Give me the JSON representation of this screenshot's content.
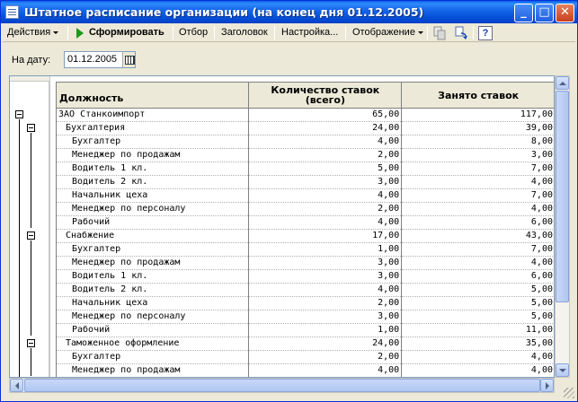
{
  "window": {
    "title": "Штатное расписание организации (на конец дня 01.12.2005)",
    "minimize": "_",
    "maximize": "□",
    "close": "✕"
  },
  "toolbar": {
    "actions": "Действия",
    "generate": "Сформировать",
    "filter": "Отбор",
    "header": "Заголовок",
    "settings": "Настройка...",
    "display": "Отображение",
    "help": "?"
  },
  "date_field": {
    "label": "На дату:",
    "value": "01.12.2005"
  },
  "table": {
    "columns": [
      "Должность",
      "Количество ставок (всего)",
      "Занято ставок"
    ],
    "rows": [
      {
        "level": 0,
        "name": "ЗАО Станкоимпорт",
        "total": "65,00",
        "occupied": "117,00"
      },
      {
        "level": 1,
        "name": "Бухгалтерия",
        "total": "24,00",
        "occupied": "39,00"
      },
      {
        "level": 2,
        "name": "Бухгалтер",
        "total": "4,00",
        "occupied": "8,00"
      },
      {
        "level": 2,
        "name": "Менеджер по продажам",
        "total": "2,00",
        "occupied": "3,00"
      },
      {
        "level": 2,
        "name": "Водитель 1 кл.",
        "total": "5,00",
        "occupied": "7,00"
      },
      {
        "level": 2,
        "name": "Водитель 2 кл.",
        "total": "3,00",
        "occupied": "4,00"
      },
      {
        "level": 2,
        "name": "Начальник цеха",
        "total": "4,00",
        "occupied": "7,00"
      },
      {
        "level": 2,
        "name": "Менеджер по персоналу",
        "total": "2,00",
        "occupied": "4,00"
      },
      {
        "level": 2,
        "name": "Рабочий",
        "total": "4,00",
        "occupied": "6,00"
      },
      {
        "level": 1,
        "name": "Снабжение",
        "total": "17,00",
        "occupied": "43,00"
      },
      {
        "level": 2,
        "name": "Бухгалтер",
        "total": "1,00",
        "occupied": "7,00"
      },
      {
        "level": 2,
        "name": "Менеджер по продажам",
        "total": "3,00",
        "occupied": "4,00"
      },
      {
        "level": 2,
        "name": "Водитель 1 кл.",
        "total": "3,00",
        "occupied": "6,00"
      },
      {
        "level": 2,
        "name": "Водитель 2 кл.",
        "total": "4,00",
        "occupied": "5,00"
      },
      {
        "level": 2,
        "name": "Начальник цеха",
        "total": "2,00",
        "occupied": "5,00"
      },
      {
        "level": 2,
        "name": "Менеджер по персоналу",
        "total": "3,00",
        "occupied": "5,00"
      },
      {
        "level": 2,
        "name": "Рабочий",
        "total": "1,00",
        "occupied": "11,00"
      },
      {
        "level": 1,
        "name": "Таможенное оформление",
        "total": "24,00",
        "occupied": "35,00"
      },
      {
        "level": 2,
        "name": "Бухгалтер",
        "total": "2,00",
        "occupied": "4,00"
      },
      {
        "level": 2,
        "name": "Менеджер по продажам",
        "total": "4,00",
        "occupied": "4,00"
      }
    ]
  }
}
